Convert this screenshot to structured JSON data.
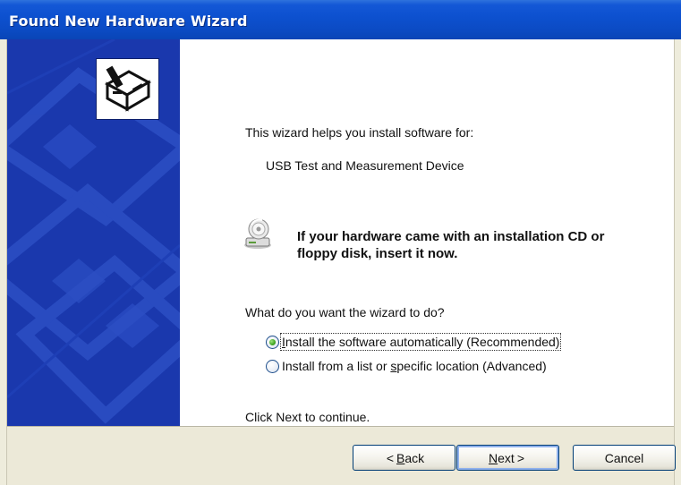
{
  "window": {
    "title": "Found New Hardware Wizard"
  },
  "sidebar": {
    "icon": "hardware-install-icon"
  },
  "content": {
    "intro": "This wizard helps you install software for:",
    "device_name": "USB Test and Measurement Device",
    "cd_icon": "cd-drive-icon",
    "cd_prompt_line1": "If your hardware came with an installation CD or",
    "cd_prompt_line2": "floppy disk, insert it now.",
    "question": "What do you want the wizard to do?",
    "options": [
      {
        "pre": "",
        "accel": "I",
        "post": "nstall the software automatically (Recommended)",
        "selected": true
      },
      {
        "pre": "Install from a list or ",
        "accel": "s",
        "post": "pecific location (Advanced)",
        "selected": false
      }
    ],
    "continue_hint": "Click Next to continue."
  },
  "buttons": {
    "back": {
      "arrow": "<",
      "accel": "B",
      "rest": "ack"
    },
    "next": {
      "accel": "N",
      "rest": "ext",
      "arrow": ">"
    },
    "cancel": "Cancel"
  },
  "colors": {
    "titlebar": "#0b4bc4",
    "side_panel": "#1a38ad",
    "button_bar": "#ece9d8",
    "radio_selected": "#3fa521"
  }
}
